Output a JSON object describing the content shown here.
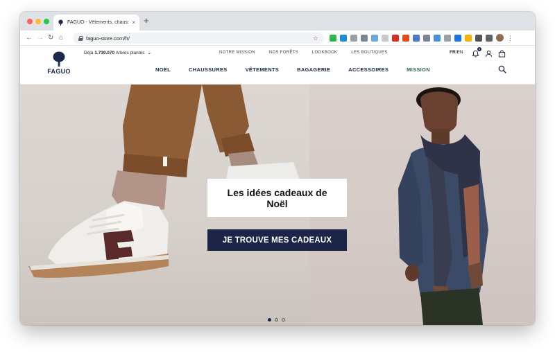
{
  "browser": {
    "tab_title": "FAGUO - Vêtements, chaussur",
    "tab_close": "×",
    "new_tab": "+",
    "url": "faguo-store.com/fr/",
    "back": "←",
    "forward": "→",
    "reload": "↻",
    "home": "⌂",
    "bookmark_icon": "☆",
    "menu": "⋮",
    "extension_colors": [
      "#2eb84b",
      "#1a8fd6",
      "#9aa0a6",
      "#7b8794",
      "#6ea8e0",
      "#c9c9c9",
      "#d93025",
      "#e64a19",
      "#4a79c9",
      "#7b8794",
      "#4a90d9",
      "#9aa0a6",
      "#1a73e8",
      "#f4b400",
      "#555555",
      "#5f6368"
    ]
  },
  "site": {
    "logo_text": "FAGUO",
    "counter_prefix": "Déjà",
    "counter_value": "1.739.070",
    "counter_suffix": "Arbres plantés",
    "counter_chevron": "⌄",
    "topnav": [
      "NOTRE MISSION",
      "NOS FORÊTS",
      "LOOKBOOK",
      "LES BOUTIQUES"
    ],
    "lang_active": "FR",
    "lang_sep": "/",
    "lang_other": "EN",
    "notification_count": "1",
    "mainnav": [
      "NOËL",
      "CHAUSSURES",
      "VÊTEMENTS",
      "BAGAGERIE",
      "ACCESSOIRES",
      "MISSION"
    ]
  },
  "hero": {
    "promo_title": "Les idées cadeaux de Noël",
    "cta_label": "JE TROUVE MES CADEAUX",
    "slides_total": 3,
    "slide_active": 1
  },
  "colors": {
    "brand_navy": "#1c2547",
    "mission_green": "#2f6b4a"
  }
}
